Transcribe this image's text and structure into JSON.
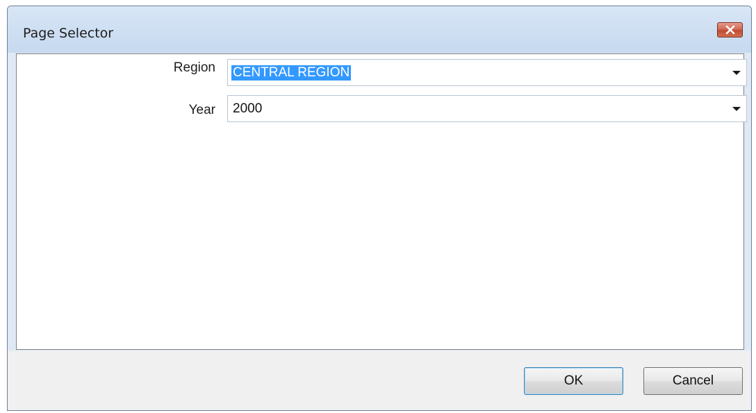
{
  "window": {
    "title": "Page Selector",
    "close_icon": "close-icon"
  },
  "form": {
    "region": {
      "label": "Region",
      "value": "CENTRAL REGION",
      "selected": true
    },
    "year": {
      "label": "Year",
      "value": "2000"
    }
  },
  "buttons": {
    "ok_label": "OK",
    "cancel_label": "Cancel"
  }
}
